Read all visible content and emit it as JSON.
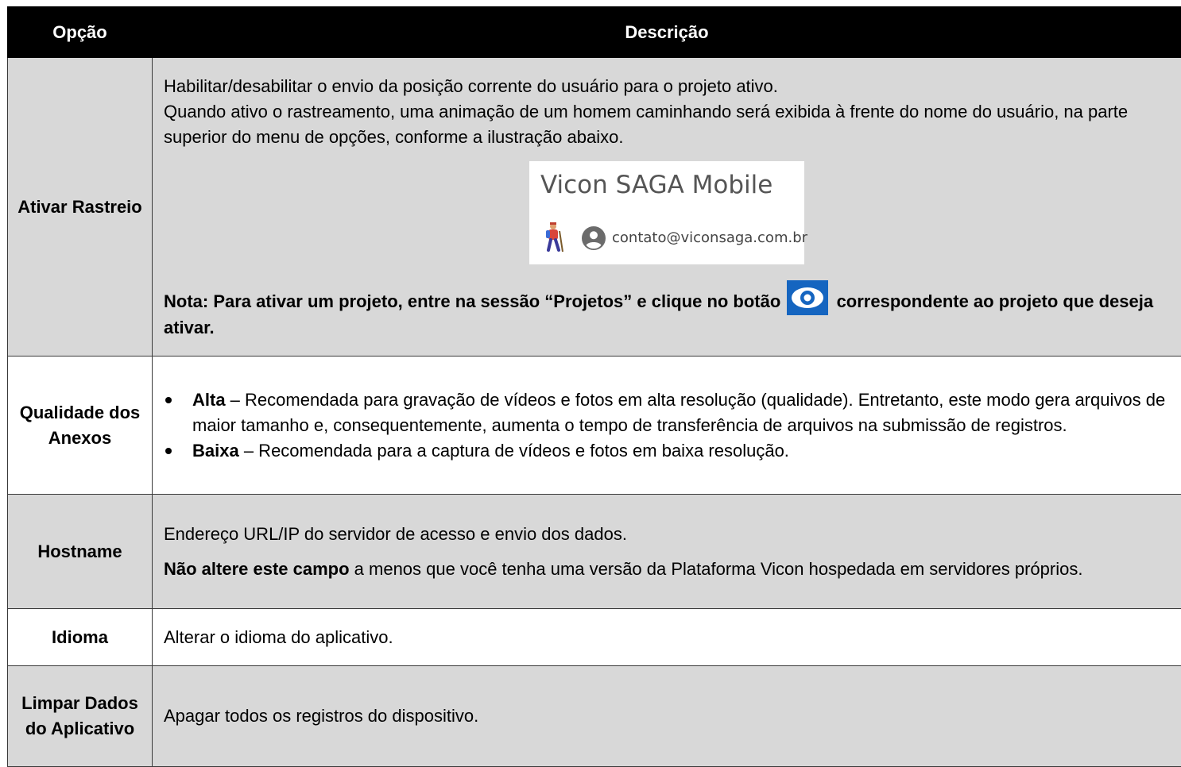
{
  "header": {
    "col_option": "Opção",
    "col_description": "Descrição"
  },
  "rows": {
    "tracking": {
      "option": "Ativar Rastreio",
      "line1": "Habilitar/desabilitar o envio da posição corrente do usuário para o projeto ativo.",
      "line2": "Quando ativo o rastreamento, uma animação de um homem caminhando será exibida à frente do nome do usuário, na parte superior do menu de opções, conforme a ilustração abaixo.",
      "sample": {
        "app_title": "Vicon SAGA Mobile",
        "email": "contato@viconsaga.com.br",
        "hiker_icon": "hiker-icon",
        "avatar_icon": "account-circle-icon"
      },
      "note_before": "Nota: Para ativar um projeto, entre na sessão “Projetos” e clique no botão",
      "note_after": "correspondente ao projeto que deseja ativar.",
      "eye_icon": "eye-icon",
      "eye_color": "#1565c0"
    },
    "quality": {
      "option": "Qualidade dos Anexos",
      "items": [
        {
          "term": "Alta",
          "text": " – Recomendada para gravação de vídeos e fotos em alta resolução (qualidade). Entretanto, este modo gera arquivos de maior tamanho e, consequentemente, aumenta o tempo de transferência de arquivos na submissão de registros."
        },
        {
          "term": "Baixa",
          "text": " – Recomendada para a captura de vídeos e fotos em baixa resolução."
        }
      ]
    },
    "hostname": {
      "option": "Hostname",
      "line1": "Endereço URL/IP do servidor de acesso e envio dos dados.",
      "bold": "Não altere este campo",
      "rest": " a menos que você tenha uma versão da Plataforma Vicon hospedada em servidores próprios."
    },
    "language": {
      "option": "Idioma",
      "text": "Alterar o idioma do aplicativo."
    },
    "clear": {
      "option": "Limpar Dados do Aplicativo",
      "text": "Apagar todos os registros do dispositivo."
    }
  }
}
